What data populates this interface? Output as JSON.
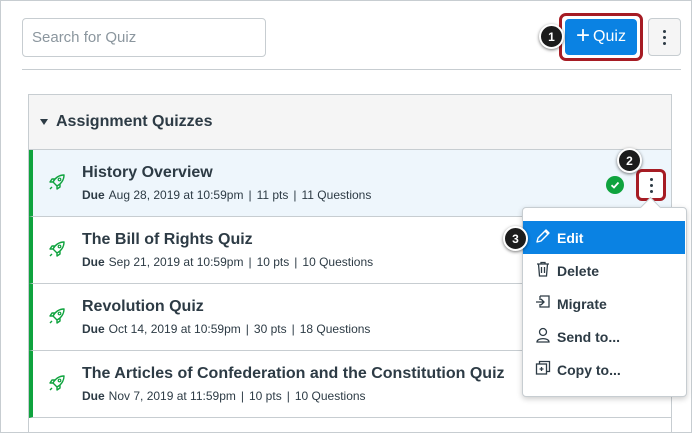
{
  "search": {
    "placeholder": "Search for Quiz"
  },
  "toolbar": {
    "add_quiz_label": "Quiz",
    "add_quiz_icon": "plus-icon",
    "more_icon": "kebab-icon"
  },
  "callouts": {
    "one": "1",
    "two": "2",
    "three": "3"
  },
  "group": {
    "title": "Assignment Quizzes"
  },
  "quizzes": [
    {
      "title": "History Overview",
      "due_label": "Due",
      "due": "Aug 28, 2019 at 10:59pm",
      "points": "11 pts",
      "questions": "11 Questions",
      "highlighted": true,
      "published": true
    },
    {
      "title": "The Bill of Rights Quiz",
      "due_label": "Due",
      "due": "Sep 21, 2019 at 10:59pm",
      "points": "10 pts",
      "questions": "10 Questions"
    },
    {
      "title": "Revolution Quiz",
      "due_label": "Due",
      "due": "Oct 14, 2019 at 10:59pm",
      "points": "30 pts",
      "questions": "18 Questions"
    },
    {
      "title": "The Articles of Confederation and the Constitution Quiz",
      "due_label": "Due",
      "due": "Nov 7, 2019 at 11:59pm",
      "points": "10 pts",
      "questions": "10 Questions"
    }
  ],
  "menu": {
    "items": [
      {
        "label": "Edit",
        "icon": "pencil-icon"
      },
      {
        "label": "Delete",
        "icon": "trash-icon"
      },
      {
        "label": "Migrate",
        "icon": "migrate-icon"
      },
      {
        "label": "Send to...",
        "icon": "user-icon"
      },
      {
        "label": "Copy to...",
        "icon": "copy-icon"
      }
    ]
  },
  "colors": {
    "accent": "#0a82e3",
    "callout_border": "#a61c24",
    "published": "#0fa33e",
    "text": "#2d3b45"
  }
}
